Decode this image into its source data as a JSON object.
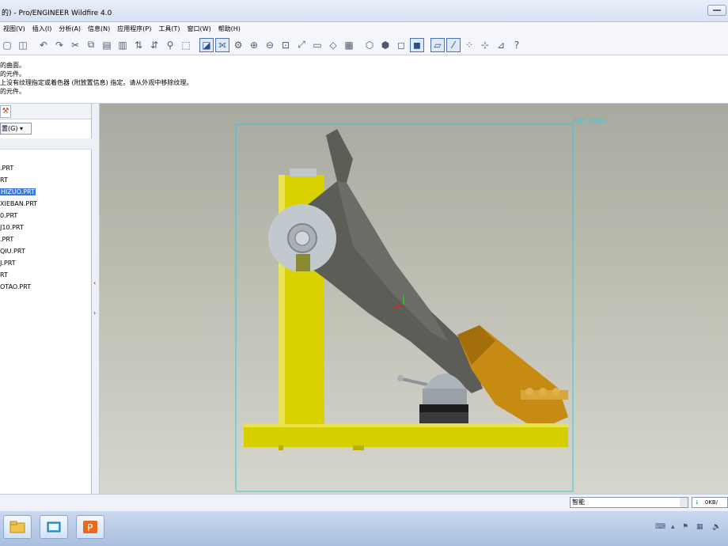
{
  "window": {
    "title": "的) - Pro/ENGINEER Wildfire 4.0"
  },
  "menubar": {
    "items": [
      "视图(V)",
      "插入(I)",
      "分析(A)",
      "信息(N)",
      "应用程序(P)",
      "工具(T)",
      "窗口(W)",
      "帮助(H)"
    ]
  },
  "toolbar": {
    "icons": [
      "open-icon",
      "save-icon",
      "undo-icon",
      "redo-icon",
      "cut-icon",
      "copy-icon",
      "paste-icon",
      "paste-special-icon",
      "regenerate-icon",
      "regenerate-manager-icon",
      "find-icon",
      "select-box-icon",
      "repaint-icon",
      "spin-center-icon",
      "orient-icon",
      "zoom-in-icon",
      "zoom-out-icon",
      "refit-icon",
      "reorient-icon",
      "saved-views-icon",
      "layers-icon",
      "view-manager-icon",
      "wireframe-icon",
      "hidden-line-icon",
      "no-hidden-icon",
      "shading-icon",
      "datum-planes-icon",
      "datum-axes-icon",
      "datum-points-icon",
      "csys-icon",
      "context-help-icon"
    ]
  },
  "messages": [
    "的曲面。",
    "的元件。",
    "上没有纹理指定或着色器 (附放置信息) 指定。请从外观中移除纹理。",
    "的元件。"
  ],
  "model_tree": {
    "show_label": "置(G) ▾",
    "items": [
      ".PRT",
      "RT",
      "HIZUO.PRT",
      "XIEBAN.PRT",
      "0.PRT",
      "J10.PRT",
      ".PRT",
      "QIU.PRT",
      "J.PRT",
      "RT",
      "OTAO.PRT"
    ],
    "selected_index": 2
  },
  "graphics": {
    "csys_label": "ASM_FRONT",
    "colors": {
      "frame": "#38c9d6",
      "yellow": "#d9d200",
      "orange": "#c88a12",
      "lever": "#5f5f5a",
      "metal": "#b9bfc4"
    }
  },
  "statusbar": {
    "filter_value": "智能",
    "progress_text": "0KB/"
  },
  "taskbar": {
    "apps": [
      "file-explorer-icon",
      "window-switcher-icon",
      "powerpoint-icon"
    ]
  }
}
